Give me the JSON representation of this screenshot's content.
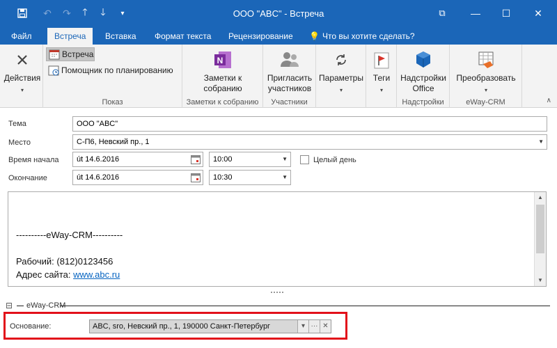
{
  "window": {
    "title": "ООО \"ABC\" - Встреча",
    "restore_ribbon_glyph": "⧉",
    "minimize_glyph": "—",
    "maximize_glyph": "☐",
    "close_glyph": "✕"
  },
  "quick_access": [
    "save-icon",
    "undo-icon",
    "redo-icon",
    "up-icon",
    "down-icon",
    "customize-icon"
  ],
  "tabs": [
    {
      "label": "Файл"
    },
    {
      "label": "Встреча"
    },
    {
      "label": "Вставка"
    },
    {
      "label": "Формат текста"
    },
    {
      "label": "Рецензирование"
    }
  ],
  "tell_me": "Что вы хотите сделать?",
  "ribbon": {
    "actions": {
      "label": "Действия"
    },
    "show": {
      "meeting": "Встреча",
      "scheduling": "Помощник по планированию",
      "group_label": "Показ"
    },
    "notes": {
      "label_1": "Заметки к",
      "label_2": "собранию",
      "group_label": "Заметки к собранию"
    },
    "attendees": {
      "label_1": "Пригласить",
      "label_2": "участников",
      "group_label": "Участники"
    },
    "options": {
      "label": "Параметры"
    },
    "tags": {
      "label": "Теги"
    },
    "addins": {
      "label_1": "Надстройки",
      "label_2": "Office",
      "group_label": "Надстройки"
    },
    "convert": {
      "label": "Преобразовать",
      "group_label": "eWay-CRM"
    }
  },
  "form": {
    "subject_label": "Тема",
    "subject_value": "ООО \"ABC\"",
    "location_label": "Место",
    "location_value": "С-П6, Невский пр., 1",
    "start_label": "Время начала",
    "start_date": "út 14.6.2016",
    "start_time": "10:00",
    "all_day_label": "Целый день",
    "end_label": "Окончание",
    "end_date": "út 14.6.2016",
    "end_time": "10:30"
  },
  "body": {
    "separator": "----------eWay-CRM----------",
    "phone": "Рабочий: (812)0123456",
    "site_prefix": "Адрес сайта: ",
    "site_link": "www.abc.ru"
  },
  "eway": {
    "section_title": "eWay-CRM",
    "collapse_glyph": "⊟",
    "basis_label": "Основание:",
    "basis_value": "ABC, sro, Невский пр., 1, 190000 Санкт-Петербург",
    "more_glyph": "···",
    "clear_glyph": "✕"
  },
  "colors": {
    "accent": "#1b66b8",
    "highlight_border": "#e2101a",
    "link": "#0563c1"
  }
}
